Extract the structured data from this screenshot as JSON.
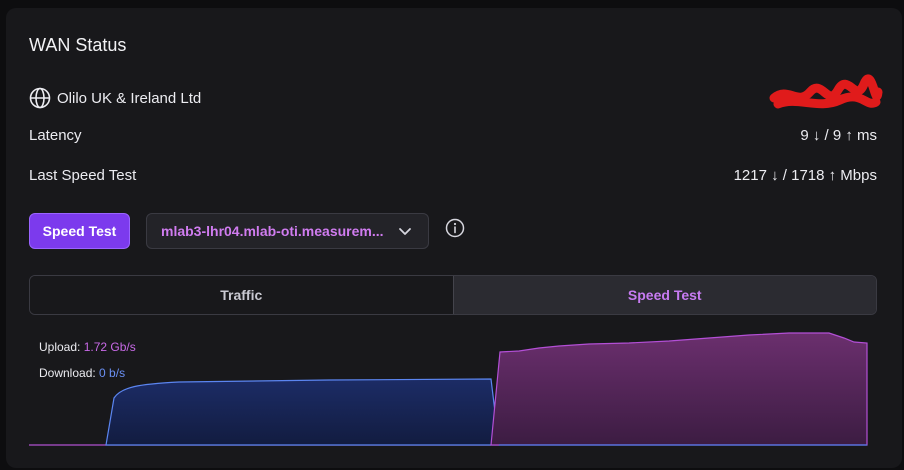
{
  "title": "WAN Status",
  "isp": {
    "name": "Olilo UK & Ireland Ltd",
    "icon": "globe-icon"
  },
  "latency": {
    "label": "Latency",
    "value": "9 ↓ / 9 ↑ ms"
  },
  "last_speed_test": {
    "label": "Last Speed Test",
    "value": "1217 ↓ / 1718 ↑ Mbps"
  },
  "controls": {
    "speed_test_button": "Speed Test",
    "server_select": "mlab3-lhr04.mlab-oti.measurem..."
  },
  "tabs": [
    {
      "label": "Traffic",
      "active": false
    },
    {
      "label": "Speed Test",
      "active": true
    }
  ],
  "legend": {
    "upload_label": "Upload:",
    "upload_value": "1.72 Gb/s",
    "download_label": "Download:",
    "download_value": "0 b/s"
  },
  "colors": {
    "accent": "#7c3aed",
    "upload": "#c96ae8",
    "download": "#4f7be8"
  }
}
